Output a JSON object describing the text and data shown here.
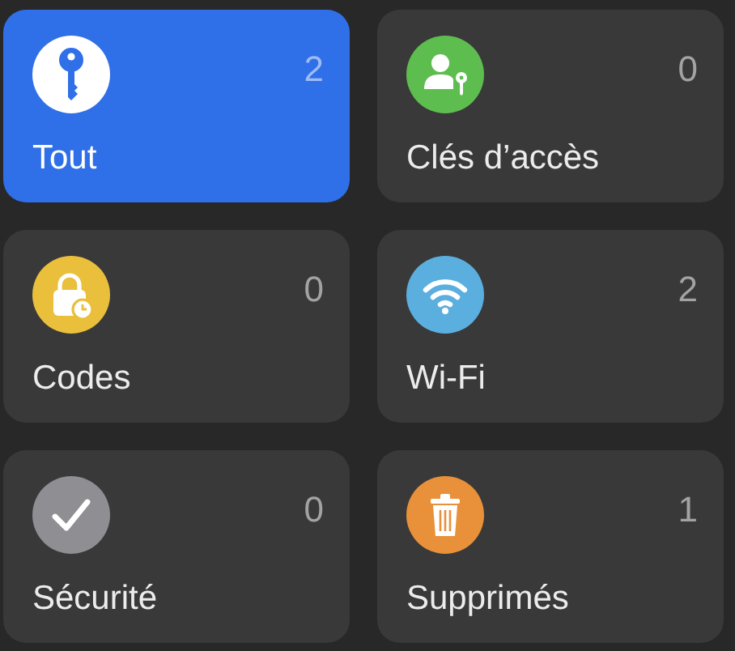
{
  "categories": [
    {
      "label": "Tout",
      "count": "2",
      "kind": "key",
      "color": "#ffffff",
      "selected": true
    },
    {
      "label": "Clés d’accès",
      "count": "0",
      "kind": "passkey",
      "color": "#5ebd4f",
      "selected": false
    },
    {
      "label": "Codes",
      "count": "0",
      "kind": "code",
      "color": "#e9bf3c",
      "selected": false
    },
    {
      "label": "Wi-Fi",
      "count": "2",
      "kind": "wifi",
      "color": "#5aafdf",
      "selected": false
    },
    {
      "label": "Sécurité",
      "count": "0",
      "kind": "security",
      "color": "#8e8e93",
      "selected": false
    },
    {
      "label": "Supprimés",
      "count": "1",
      "kind": "trash",
      "color": "#e8913a",
      "selected": false
    }
  ]
}
